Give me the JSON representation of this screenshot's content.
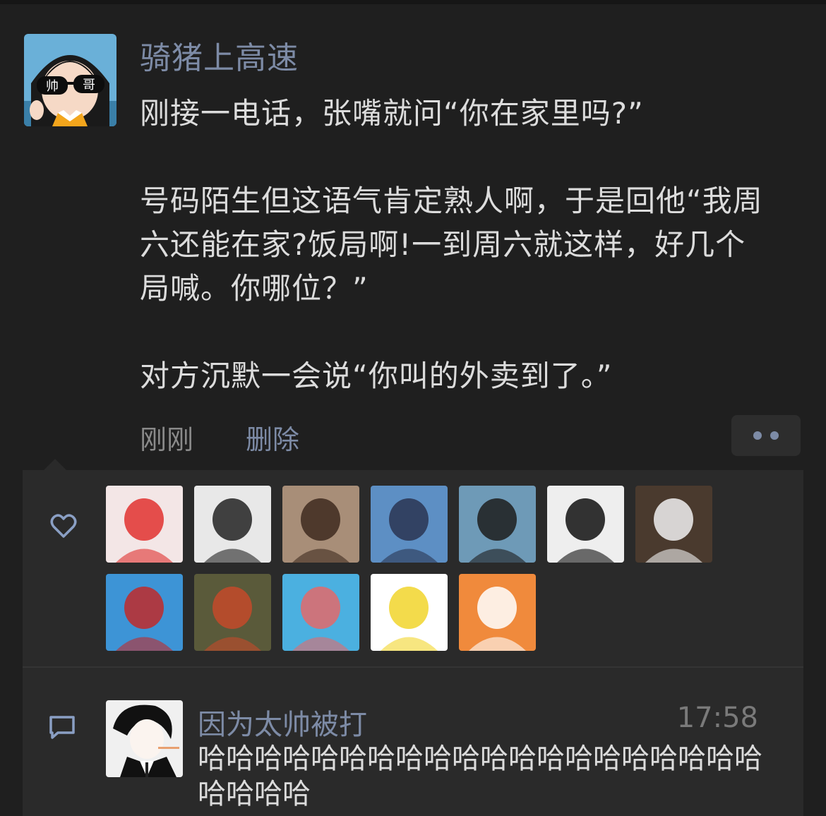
{
  "post": {
    "author": "骑猪上高速",
    "avatar_badge": [
      "帅",
      "哥"
    ],
    "text": "刚接一电话，张嘴就问“你在家里吗?”\n\n号码陌生但这语气肯定熟人啊，于是回他“我周六还能在家?饭局啊!一到周六就这样，好几个局喊。你哪位？”\n\n对方沉默一会说“你叫的外卖到了。”",
    "time": "刚刚",
    "delete_label": "删除"
  },
  "likes": {
    "icon": "heart-icon",
    "avatars": [
      {
        "name": "red-fox-cartoon",
        "bg": "#f3e6e6",
        "accent": "#e0312f"
      },
      {
        "name": "batman-cartoon",
        "bg": "#e8e8e8",
        "accent": "#222222"
      },
      {
        "name": "girl-photo",
        "bg": "#a88e78",
        "accent": "#3e2a1e"
      },
      {
        "name": "conan-cartoon",
        "bg": "#5d8fc4",
        "accent": "#2a3552"
      },
      {
        "name": "woman-selfie",
        "bg": "#6e9ab7",
        "accent": "#1d1d1d"
      },
      {
        "name": "suit-man-drawing",
        "bg": "#eeeeee",
        "accent": "#111111"
      },
      {
        "name": "man-white-shirt",
        "bg": "#4a3a2e",
        "accent": "#f0f0f0"
      },
      {
        "name": "maruko-cartoon",
        "bg": "#3d94d6",
        "accent": "#c02a2a"
      },
      {
        "name": "fox-couple-cartoon",
        "bg": "#5a5a3a",
        "accent": "#c44a2a"
      },
      {
        "name": "boy-back-cartoon",
        "bg": "#4bb0e0",
        "accent": "#e36a6a"
      },
      {
        "name": "homer-cartoon",
        "bg": "#ffffff",
        "accent": "#f1d52b"
      },
      {
        "name": "panda-cartoon",
        "bg": "#f08a3c",
        "accent": "#ffffff"
      }
    ]
  },
  "comment": {
    "icon": "comment-icon",
    "author": "因为太帅被打",
    "time": "17:58",
    "text": "哈哈哈哈哈哈哈哈哈哈哈哈哈哈哈哈哈哈哈哈哈哈哈哈"
  }
}
